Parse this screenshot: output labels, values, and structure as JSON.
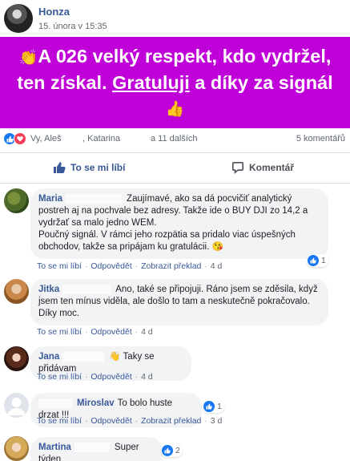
{
  "post": {
    "author": "Honza",
    "timestamp": "15. února v 15:35",
    "banner": {
      "emoji_start": "👏",
      "text_before_link": "A 026 velký respekt, kdo vydržel, ten získal. ",
      "link_text": "Gratuluji",
      "text_after_link": " a díky za signál",
      "emoji_end": "👍",
      "background": "#c000d8",
      "text_color": "#ffffff"
    }
  },
  "reactions": {
    "icons": [
      "like-icon",
      "heart-icon"
    ],
    "reactor_a": "Vy, Aleš",
    "reactor_b": ", Katarina",
    "reactor_c": "a 11 dalších",
    "comments_count": "5 komentářů"
  },
  "actions": {
    "like_label": "To se mi líbí",
    "comment_label": "Komentář"
  },
  "comments": [
    {
      "name": "Maria",
      "text": "Zaujímavé, ako sa dá pocvičiť analytický postreh aj na pochvale bez adresy. Takže ide o BUY DJI zo 14,2 a vydržať sa malo jedno WEM.",
      "text2": "Poučný signál. V rámci jeho rozpätia sa pridalo viac úspešných obchodov, takže sa pripájam ku gratulácii.",
      "emoji": "😘",
      "like": "To se mi líbí",
      "reply": "Odpovědět",
      "translate": "Zobrazit překlad",
      "time": "4 d",
      "reaction_count": "1"
    },
    {
      "name": "Jitka",
      "text": "Ano, také se připojuji. Ráno jsem se zděsila, když jsem ten mínus viděla, ale došlo to tam a neskutečně pokračovalo. Díky moc.",
      "like": "To se mi líbí",
      "reply": "Odpovědět",
      "time": "4 d"
    },
    {
      "name": "Jana",
      "emoji": "👋",
      "text": "Taky se přidávam",
      "like": "To se mi líbí",
      "reply": "Odpovědět",
      "time": "4 d"
    },
    {
      "name": "Miroslav",
      "text": "To bolo huste drzat !!!",
      "like": "To se mi líbí",
      "reply": "Odpovědět",
      "translate": "Zobrazit překlad",
      "time": "3 d",
      "reaction_count": "1"
    },
    {
      "name": "Martina",
      "text": "Super týden",
      "reaction_count": "2"
    }
  ],
  "colors": {
    "link": "#385898",
    "like_blue": "#1877f2",
    "heart_red": "#f33e58",
    "bubble_bg": "#f2f3f5"
  }
}
